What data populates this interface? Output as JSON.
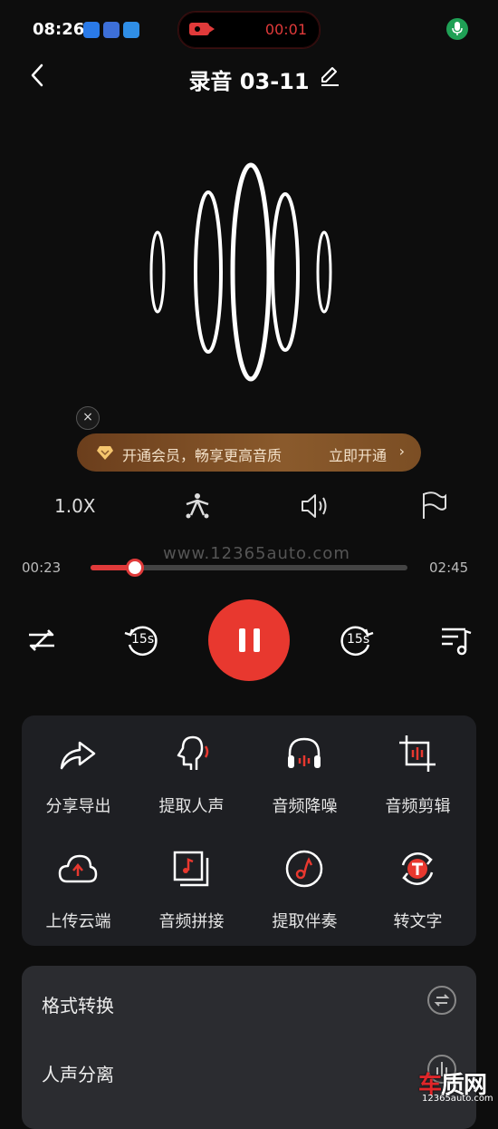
{
  "status_bar": {
    "time": "08:26",
    "recording_time": "00:01"
  },
  "header": {
    "title": "录音 03-11"
  },
  "vip": {
    "text": "开通会员，畅享更高音质",
    "cta": "立即开通",
    "close": "×"
  },
  "controls": {
    "speed": "1.0X"
  },
  "progress": {
    "current": "00:23",
    "total": "02:45",
    "fraction": 0.14,
    "watermark": "www.12365auto.com"
  },
  "playback": {
    "rewind_label": "15s",
    "forward_label": "15s",
    "state": "playing"
  },
  "tools": [
    {
      "label": "分享导出",
      "icon": "share-icon"
    },
    {
      "label": "提取人声",
      "icon": "voice-extract-icon"
    },
    {
      "label": "音频降噪",
      "icon": "headphones-icon"
    },
    {
      "label": "音频剪辑",
      "icon": "crop-icon"
    },
    {
      "label": "上传云端",
      "icon": "cloud-upload-icon"
    },
    {
      "label": "音频拼接",
      "icon": "audio-merge-icon"
    },
    {
      "label": "提取伴奏",
      "icon": "music-note-icon"
    },
    {
      "label": "转文字",
      "icon": "text-convert-icon"
    }
  ],
  "list": [
    {
      "label": "格式转换",
      "icon": "convert-icon"
    },
    {
      "label": "人声分离",
      "icon": "separate-icon"
    }
  ],
  "logo": {
    "main_a": "车",
    "main_b": "质网",
    "sub": "12365auto.com"
  },
  "colors": {
    "accent": "#e8382f",
    "panel": "#1e1f23",
    "vip_text": "#f3e1c9"
  }
}
